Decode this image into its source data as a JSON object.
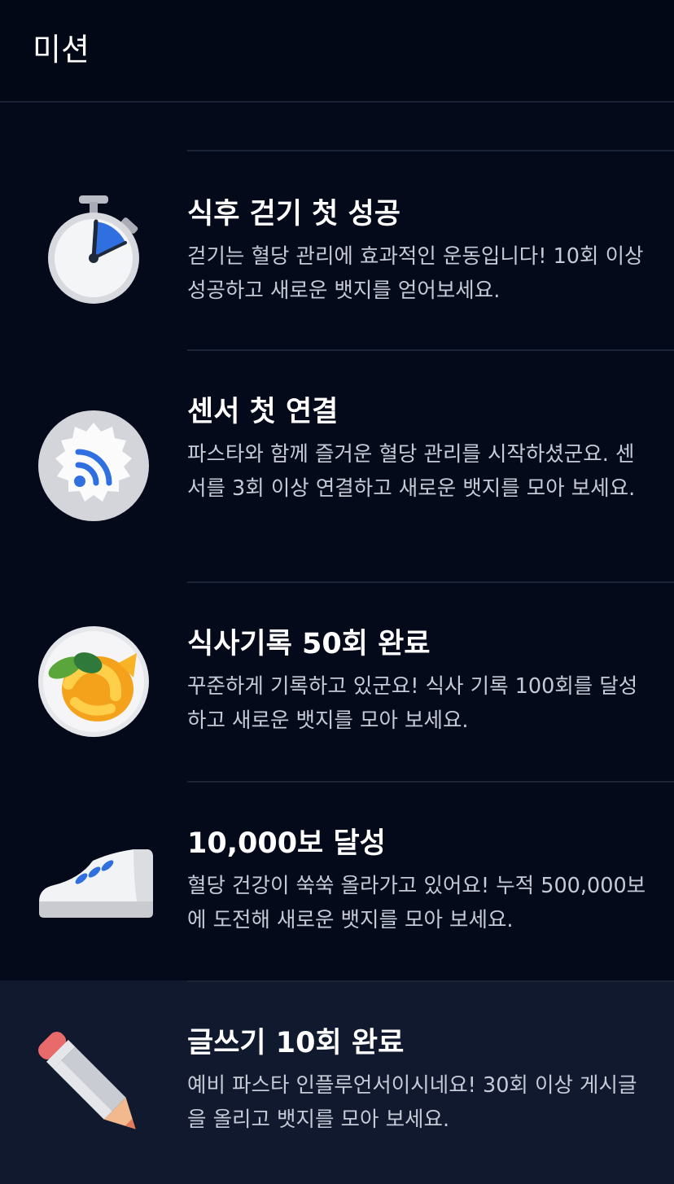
{
  "header": {
    "title": "미션"
  },
  "missions": [
    {
      "icon": "stopwatch-icon",
      "title": "식후 걷기 첫 성공",
      "description": "걷기는 혈당 관리에 효과적인 운동입니다! 10회 이상 성공하고 새로운 뱃지를 얻어보세요."
    },
    {
      "icon": "sensor-signal-icon",
      "title": "센서 첫 연결",
      "description": "파스타와 함께 즐거운 혈당 관리를 시작하셨군요. 센서를 3회 이상 연결하고 새로운 뱃지를 모아 보세요."
    },
    {
      "icon": "pasta-plate-icon",
      "title": "식사기록 50회 완료",
      "description": "꾸준하게 기록하고 있군요! 식사 기록 100회를 달성하고 새로운 뱃지를 모아 보세요."
    },
    {
      "icon": "sneaker-icon",
      "title": "10,000보 달성",
      "description": "혈당 건강이 쑥쑥 올라가고 있어요! 누적 500,000보에 도전해 새로운 뱃지를 모아 보세요."
    },
    {
      "icon": "pencil-icon",
      "title": "글쓰기 10회 완료",
      "description": "예비 파스타 인플루언서이시네요! 30회 이상 게시글을 올리고 뱃지를 모아 보세요."
    }
  ],
  "colors": {
    "background": "#050a1b",
    "highlight_row": "#10192e",
    "accent_blue": "#2f6fe0"
  }
}
